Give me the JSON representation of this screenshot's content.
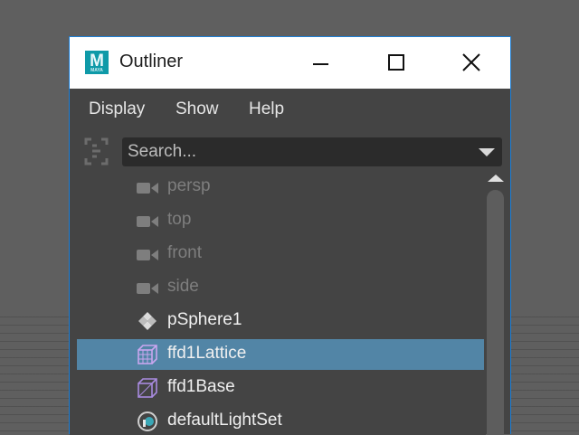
{
  "window": {
    "title": "Outliner",
    "logo_letter": "M",
    "logo_sub": "MAYA"
  },
  "menu": [
    "Display",
    "Show",
    "Help"
  ],
  "search": {
    "placeholder": "Search..."
  },
  "tree": [
    {
      "label": "persp",
      "icon": "camera-icon",
      "style": "dim"
    },
    {
      "label": "top",
      "icon": "camera-icon",
      "style": "dim"
    },
    {
      "label": "front",
      "icon": "camera-icon",
      "style": "dim"
    },
    {
      "label": "side",
      "icon": "camera-icon",
      "style": "dim"
    },
    {
      "label": "pSphere1",
      "icon": "mesh-transform-icon",
      "style": "bright"
    },
    {
      "label": "ffd1Lattice",
      "icon": "lattice-icon",
      "style": "bright",
      "selected": true
    },
    {
      "label": "ffd1Base",
      "icon": "lattice-base-icon",
      "style": "bright"
    },
    {
      "label": "defaultLightSet",
      "icon": "light-set-icon",
      "style": "bright"
    }
  ],
  "colors": {
    "selection": "#5285a6",
    "window_border": "#1e7fd6",
    "logo": "#0f9aa8"
  }
}
